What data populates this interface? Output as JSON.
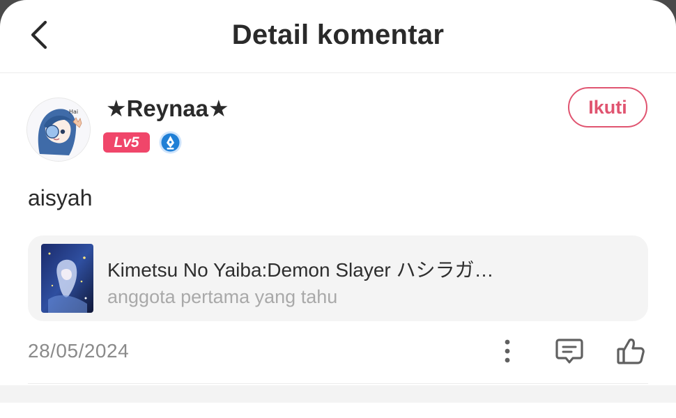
{
  "header": {
    "title": "Detail komentar",
    "back_icon": "chevron-left-icon"
  },
  "user": {
    "name": "★Reynaa★",
    "level": "Lv5",
    "level_color": "#f0466a",
    "badge_icon": "pen-nib-icon",
    "follow_label": "Ikuti",
    "follow_color": "#e05470"
  },
  "comment": {
    "text": "aisyah"
  },
  "book": {
    "title": "Kimetsu No Yaiba:Demon Slayer ハシラガ…",
    "subtitle": "anggota pertama yang tahu"
  },
  "footer": {
    "date": "28/05/2024",
    "actions": [
      "more-vertical-icon",
      "comment-icon",
      "thumbs-up-icon"
    ]
  }
}
